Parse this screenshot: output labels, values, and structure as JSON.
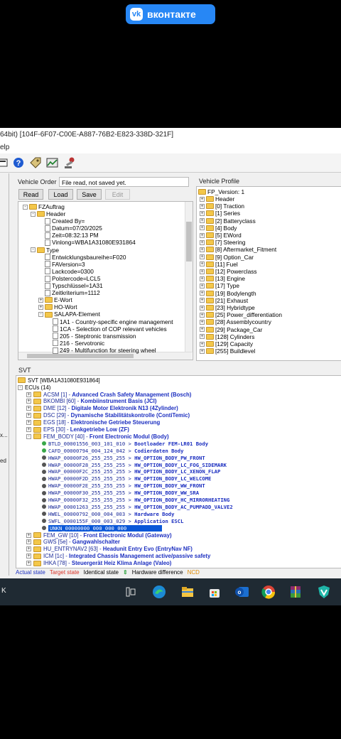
{
  "vk_badge": {
    "label": "вконтакте"
  },
  "window": {
    "title": "64bit) [104F-6F07-C00E-A887-76B2-E823-338D-321F]",
    "menu": "elp"
  },
  "vehicle_order": {
    "label": "Vehicle Order",
    "status": "File read, not saved yet.",
    "buttons": {
      "read": "Read",
      "load": "Load",
      "save": "Save",
      "edit": "Edit"
    },
    "tree": [
      {
        "level": 0,
        "toggle": "-",
        "icon": "folder",
        "text": "FZAuftrag"
      },
      {
        "level": 1,
        "toggle": "-",
        "icon": "folder",
        "text": "Header"
      },
      {
        "level": 2,
        "toggle": "",
        "icon": "doc",
        "text": "Created By="
      },
      {
        "level": 2,
        "toggle": "",
        "icon": "doc",
        "text": "Datum=07/20/2025"
      },
      {
        "level": 2,
        "toggle": "",
        "icon": "doc",
        "text": "Zeit=08:32:13 PM"
      },
      {
        "level": 2,
        "toggle": "",
        "icon": "doc",
        "text": "Vinlong=WBA1A31080E931864"
      },
      {
        "level": 1,
        "toggle": "-",
        "icon": "folder",
        "text": "Type"
      },
      {
        "level": 2,
        "toggle": "",
        "icon": "doc",
        "text": "Entwicklungsbaureihe=F020"
      },
      {
        "level": 2,
        "toggle": "",
        "icon": "doc",
        "text": "FAVersion=3"
      },
      {
        "level": 2,
        "toggle": "",
        "icon": "doc",
        "text": "Lackcode=0300"
      },
      {
        "level": 2,
        "toggle": "",
        "icon": "doc",
        "text": "Polstercode=LCL5"
      },
      {
        "level": 2,
        "toggle": "",
        "icon": "doc",
        "text": "Typschlüssel=1A31"
      },
      {
        "level": 2,
        "toggle": "",
        "icon": "doc",
        "text": "Zeitkriterium=1112"
      },
      {
        "level": 2,
        "toggle": "+",
        "icon": "folder",
        "text": "E-Wort"
      },
      {
        "level": 2,
        "toggle": "+",
        "icon": "folder",
        "text": "HO-Wort"
      },
      {
        "level": 2,
        "toggle": "-",
        "icon": "folder",
        "text": "SALAPA-Element"
      },
      {
        "level": 3,
        "toggle": "",
        "icon": "doc",
        "text": "1A1 - Country-specific engine management"
      },
      {
        "level": 3,
        "toggle": "",
        "icon": "doc",
        "text": "1CA - Selection of COP relevant vehicles"
      },
      {
        "level": 3,
        "toggle": "",
        "icon": "doc",
        "text": "205 - Steptronic transmission"
      },
      {
        "level": 3,
        "toggle": "",
        "icon": "doc",
        "text": "216 - Servotronic"
      },
      {
        "level": 3,
        "toggle": "",
        "icon": "doc",
        "text": "249 - Multifunction for steering wheel"
      }
    ]
  },
  "vehicle_profile": {
    "label": "Vehicle Profile",
    "root": "FP_Version: 1",
    "items": [
      "Header",
      "[0] Traction",
      "[1] Series",
      "[2] Batteryclass",
      "[4] Body",
      "[5] EWord",
      "[7] Steering",
      "[8] Aftermarket_Fitment",
      "[9] Option_Car",
      "[11] Fuel",
      "[12] Powerclass",
      "[13] Engine",
      "[17] Type",
      "[19] Bodylength",
      "[21] Exhaust",
      "[23] Hybridtype",
      "[25] Power_differentiation",
      "[28] Assemblycountry",
      "[29] Package_Car",
      "[128] Cylinders",
      "[129] Capacity",
      "[255] Buildlevel"
    ]
  },
  "svt": {
    "label": "SVT",
    "root": "SVT [WBA1A31080E931864]",
    "ecus_label": "ECUs (14)",
    "rows": [
      {
        "level": 1,
        "toggle": "+",
        "code": "ACSM [1] - ",
        "name": "Advanced Crash Safety Management (Bosch)"
      },
      {
        "level": 1,
        "toggle": "+",
        "code": "BKOMBI [60] - ",
        "name": "Kombiinstrument Basis (JCI)"
      },
      {
        "level": 1,
        "toggle": "+",
        "code": "DME [12] - ",
        "name": "Digitale Motor Elektronik N13 (4Zylinder)"
      },
      {
        "level": 1,
        "toggle": "+",
        "code": "DSC [29] - ",
        "name": "Dynamische Stabilitätskontrolle (ContiTemic)"
      },
      {
        "level": 1,
        "toggle": "+",
        "code": "EGS [18] - ",
        "name": "Elektronische Getriebe Steuerung"
      },
      {
        "level": 1,
        "toggle": "+",
        "code": "EPS [30] - ",
        "name": "Lenkgetriebe Low (ZF)"
      },
      {
        "level": 1,
        "toggle": "-",
        "code": "FEM_BODY [40] - ",
        "name": "Front Electronic Modul (Body)"
      },
      {
        "level": 2,
        "dot": "#3aa84a",
        "code": "BTLD_00001556_003_101_010 > ",
        "name": "Bootloader FEM-LR01 Body"
      },
      {
        "level": 2,
        "dot": "#3aa84a",
        "code": "CAFD_00000794_004_124_042 > ",
        "name": "Codierdaten Body"
      },
      {
        "level": 2,
        "dot": "#555555",
        "code": "HWAP_00000F26_255_255_255 > ",
        "name": "HW_OPTION_BODY_PW_FRONT"
      },
      {
        "level": 2,
        "dot": "#555555",
        "code": "HWAP_00000F28_255_255_255 > ",
        "name": "HW_OPTION_BODY_LC_FOG_SIDEMARK"
      },
      {
        "level": 2,
        "dot": "#555555",
        "code": "HWAP_00000F2C_255_255_255 > ",
        "name": "HW_OPTION_BODY_LC_XENON_FLAP"
      },
      {
        "level": 2,
        "dot": "#555555",
        "code": "HWAP_00000F2D_255_255_255 > ",
        "name": "HW_OPTION_BODY_LC_WELCOME"
      },
      {
        "level": 2,
        "dot": "#555555",
        "code": "HWAP_00000F2E_255_255_255 > ",
        "name": "HW_OPTION_BODY_WW_FRONT"
      },
      {
        "level": 2,
        "dot": "#555555",
        "code": "HWAP_00000F30_255_255_255 > ",
        "name": "HW_OPTION_BODY_WW_SRA"
      },
      {
        "level": 2,
        "dot": "#555555",
        "code": "HWAP_00000F32_255_255_255 > ",
        "name": "HW_OPTION_BODY_HC_MIRRORHEATING"
      },
      {
        "level": 2,
        "dot": "#555555",
        "code": "HWAP_00001263_255_255_255 > ",
        "name": "HW_OPTION_BODY_AC_PUMPADD_VALVE2"
      },
      {
        "level": 2,
        "dot": "#555555",
        "code": "HWEL_00000792_000_004_003 > ",
        "name": "Hardware Body"
      },
      {
        "level": 2,
        "dot": "#555555",
        "code": "SWFL_0000155F_000_003_029 > ",
        "name": "Application ESCL"
      },
      {
        "level": 2,
        "dot": "#555555",
        "code": "UNKN_00000000_000_000_000",
        "name": "",
        "selected": true
      },
      {
        "level": 1,
        "toggle": "+",
        "code": "FEM_GW [10] - ",
        "name": "Front Electronic Modul (Gateway)"
      },
      {
        "level": 1,
        "toggle": "+",
        "code": "GWS [5e] - ",
        "name": "Gangwahlschalter"
      },
      {
        "level": 1,
        "toggle": "+",
        "code": "HU_ENTRYNAV2 [63] - ",
        "name": "Headunit Entry Evo (EntryNav NF)"
      },
      {
        "level": 1,
        "toggle": "+",
        "code": "ICM [1c] - ",
        "name": "Integrated Chassis Management active/passive safety"
      },
      {
        "level": 1,
        "toggle": "+",
        "code": "IHKA [78] - ",
        "name": "Steuergerät Heiz Klima Anlage (Valeo)"
      }
    ],
    "legend": {
      "actual": "Actual state",
      "target": "Target state",
      "identical": "Identical state",
      "hardware": "Hardware difference",
      "ncd": "NCD"
    }
  },
  "left_strip": {
    "text1": "x...",
    "text2": "ed"
  },
  "taskbar": {
    "left_text": "K"
  },
  "colors": {
    "accent_blue": "#1c2fc0",
    "selection": "#0a57d8",
    "legend_actual": "#1c2fc0",
    "legend_target": "#d93025",
    "legend_ncd": "#e08a00"
  }
}
